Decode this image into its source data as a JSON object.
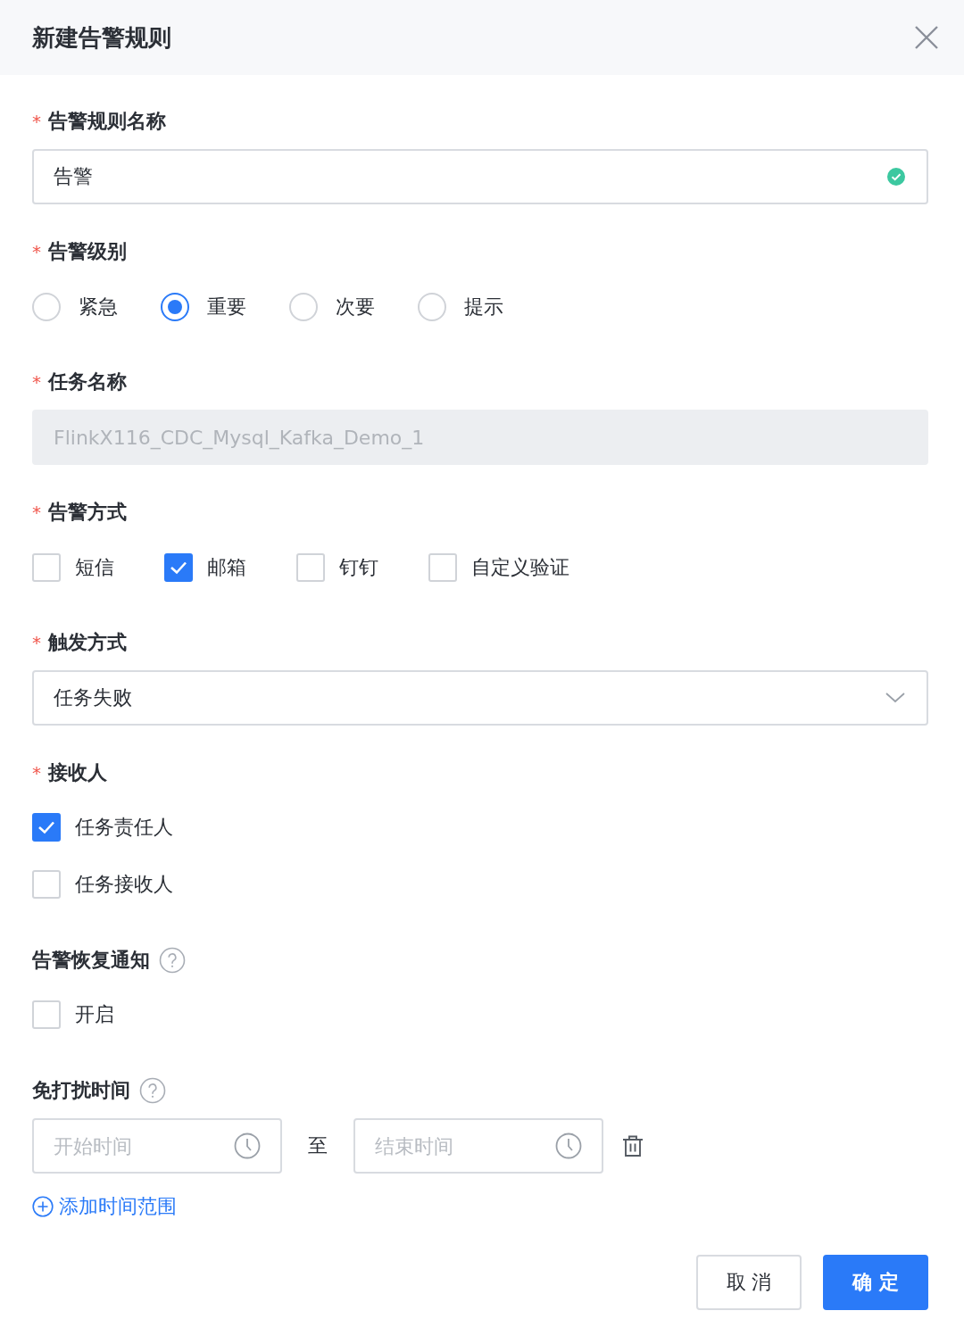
{
  "title": "新建告警规则",
  "rule_name": {
    "label": "告警规则名称",
    "required_mark": "*",
    "value": "告警",
    "valid": true
  },
  "level": {
    "label": "告警级别",
    "required_mark": "*",
    "options": [
      {
        "label": "紧急",
        "selected": false
      },
      {
        "label": "重要",
        "selected": true
      },
      {
        "label": "次要",
        "selected": false
      },
      {
        "label": "提示",
        "selected": false
      }
    ]
  },
  "task_name": {
    "label": "任务名称",
    "required_mark": "*",
    "value": "FlinkX116_CDC_Mysql_Kafka_Demo_1",
    "disabled": true
  },
  "methods": {
    "label": "告警方式",
    "required_mark": "*",
    "options": [
      {
        "label": "短信",
        "checked": false
      },
      {
        "label": "邮箱",
        "checked": true
      },
      {
        "label": "钉钉",
        "checked": false
      },
      {
        "label": "自定义验证",
        "checked": false
      }
    ]
  },
  "trigger": {
    "label": "触发方式",
    "required_mark": "*",
    "value": "任务失败"
  },
  "receivers": {
    "label": "接收人",
    "required_mark": "*",
    "options": [
      {
        "label": "任务责任人",
        "checked": true
      },
      {
        "label": "任务接收人",
        "checked": false
      }
    ]
  },
  "recovery": {
    "label": "告警恢复通知",
    "help": true,
    "options": [
      {
        "label": "开启",
        "checked": false
      }
    ]
  },
  "quiet_time": {
    "label": "免打扰时间",
    "help": true,
    "ranges": [
      {
        "start_placeholder": "开始时间",
        "separator": "至",
        "end_placeholder": "结束时间"
      }
    ],
    "add_link": "添加时间范围"
  },
  "buttons": [
    {
      "label": "取 消",
      "kind": "default"
    },
    {
      "label": "确 定",
      "kind": "primary"
    }
  ]
}
